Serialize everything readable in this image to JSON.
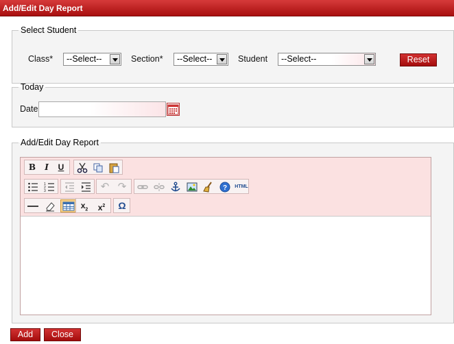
{
  "window": {
    "title": "Add/Edit Day Report"
  },
  "select_student": {
    "legend": "Select Student",
    "class_label": "Class*",
    "class_value": "--Select--",
    "section_label": "Section*",
    "section_value": "--Select--",
    "student_label": "Student",
    "student_value": "--Select--",
    "reset_label": "Reset"
  },
  "today": {
    "legend": "Today",
    "date_label": "Date",
    "date_value": ""
  },
  "report": {
    "legend": "Add/Edit Day Report",
    "toolbar": {
      "row1": [
        "bold-icon",
        "italic-icon",
        "underline-icon",
        "cut-icon",
        "copy-icon",
        "paste-icon"
      ],
      "row2": [
        "bulleted-list-icon",
        "numbered-list-icon",
        "outdent-icon",
        "indent-icon",
        "undo-icon",
        "redo-icon",
        "link-icon",
        "unlink-icon",
        "anchor-icon",
        "image-icon",
        "cleanup-icon",
        "help-icon",
        "html-icon"
      ],
      "row3": [
        "horizontal-rule-icon",
        "eraser-icon",
        "table-icon",
        "subscript-icon",
        "superscript-icon",
        "special-char-icon"
      ],
      "html_label": "HTML",
      "omega": "Ω"
    },
    "content": ""
  },
  "footer": {
    "add_label": "Add",
    "close_label": "Close"
  },
  "colors": {
    "accent_red": "#b71c1c",
    "toolbar_bg": "#fbe1e1",
    "panel_bg": "#f4f4f4"
  }
}
